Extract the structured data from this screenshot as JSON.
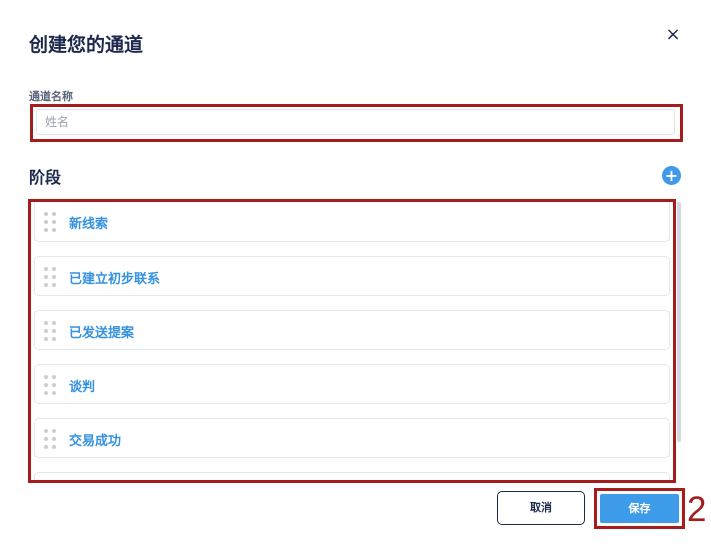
{
  "dialog": {
    "title": "创建您的通道",
    "close_glyph": "×"
  },
  "name_field": {
    "label": "通道名称",
    "placeholder": "姓名",
    "value": ""
  },
  "stages": {
    "title": "阶段",
    "add_glyph": "+",
    "items": [
      {
        "label": "新线索"
      },
      {
        "label": "已建立初步联系"
      },
      {
        "label": "已发送提案"
      },
      {
        "label": "谈判"
      },
      {
        "label": "交易成功"
      },
      {
        "label": ""
      }
    ]
  },
  "footer": {
    "cancel_label": "取消",
    "save_label": "保存"
  },
  "annotation": {
    "step_number": "2"
  },
  "colors": {
    "accent": "#3d9be9",
    "highlight": "#a51c1c",
    "text_dark": "#1d2a4d"
  }
}
